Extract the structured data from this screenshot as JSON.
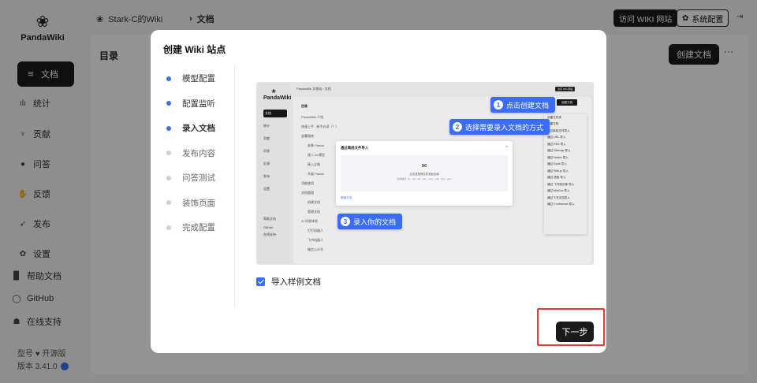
{
  "app": {
    "logo_text": "PandaWiki",
    "sidebar": {
      "items": [
        {
          "label": "文档",
          "icon": "layers-icon",
          "glyph": "≋"
        },
        {
          "label": "统计",
          "icon": "bar-chart-icon",
          "glyph": "ılı"
        },
        {
          "label": "贡献",
          "icon": "trophy-icon",
          "glyph": "♆"
        },
        {
          "label": "问答",
          "icon": "chat-icon",
          "glyph": "●"
        },
        {
          "label": "反馈",
          "icon": "hand-icon",
          "glyph": "✋"
        },
        {
          "label": "发布",
          "icon": "send-icon",
          "glyph": "➶"
        }
      ],
      "bottom_items": [
        {
          "label": "设置",
          "icon": "gear-icon",
          "glyph": "✿"
        },
        {
          "label": "帮助文档",
          "icon": "book-icon",
          "glyph": "▉"
        },
        {
          "label": "GitHub",
          "icon": "github-icon",
          "glyph": "◯"
        },
        {
          "label": "在线支持",
          "icon": "support-icon",
          "glyph": "☗"
        }
      ],
      "model_label": "型号",
      "model_value": "开源版",
      "version_label": "版本",
      "version_value": "3.41.0"
    },
    "topbar": {
      "wiki_name": "Stark-C的Wiki",
      "section": "文档",
      "visit_button": "访问 WIKI 网站",
      "settings_button": "系统配置"
    },
    "main": {
      "title": "目录",
      "create_button": "创建文档",
      "more": "···"
    }
  },
  "modal": {
    "title": "创建 Wiki 站点",
    "steps": [
      {
        "label": "模型配置",
        "state": "done"
      },
      {
        "label": "配置监听",
        "state": "done"
      },
      {
        "label": "录入文档",
        "state": "current"
      },
      {
        "label": "发布内容",
        "state": "pending"
      },
      {
        "label": "问答测试",
        "state": "pending"
      },
      {
        "label": "装饰页面",
        "state": "pending"
      },
      {
        "label": "完成配置",
        "state": "pending"
      }
    ],
    "preview": {
      "logo": "PandaWiki",
      "crumb": "PandaWiki 文档站  ›  文档",
      "top_visit": "访问 Wiki 网站",
      "create_button": "创建文档",
      "side_items": [
        "文档",
        "统计",
        "贡献",
        "问答",
        "反馈",
        "发布",
        "设置"
      ],
      "side_bottom": [
        "帮助文档",
        "GitHub",
        "在线支持"
      ],
      "rows": [
        "PandaWiki 介绍",
        "快速上手 - 新手必读（？）",
        "部署指南",
        "安装 Panda",
        "接入 AI 模型",
        "接入企微",
        "升级 Panda",
        "功能使用",
        "文档管理",
        "创建文档",
        "管理文档",
        "AI 问答体验",
        "钉钉机器人",
        "飞书机器人",
        "微信公众号"
      ],
      "dropdown": [
        "创建文件夹",
        "创建文档",
        "通过离线文件导入",
        "通过 URL 导入",
        "通过 RSS 导入",
        "通过 Sitemap 导入",
        "通过 Notion 导入",
        "通过 Epub 导入",
        "通过 Wiki.js 导入",
        "通过 语雀 导入",
        "通过 飞书知识库 导入",
        "通过 MinDoc 导入",
        "通过飞书文档导入",
        "通过 Confluence 导入"
      ],
      "dialog": {
        "title": "通过离线文件导入",
        "close": "×",
        "drop_text": "点击或拖拽文件到此区域",
        "drop_sub": "支持格式 .txt, .md, .xls, .xlsx, .docx, .pdf, .html, .pptx",
        "link": "使用方法"
      }
    },
    "callouts": [
      {
        "num": "1",
        "text": "点击创建文档"
      },
      {
        "num": "2",
        "text": "选择需要录入文档的方式"
      },
      {
        "num": "3",
        "text": "录入你的文档"
      }
    ],
    "checkbox_label": "导入样例文档",
    "next_button": "下一步"
  },
  "colors": {
    "accent": "#3b6cf6",
    "dark": "#1a1a1a",
    "highlight": "#e53935"
  }
}
